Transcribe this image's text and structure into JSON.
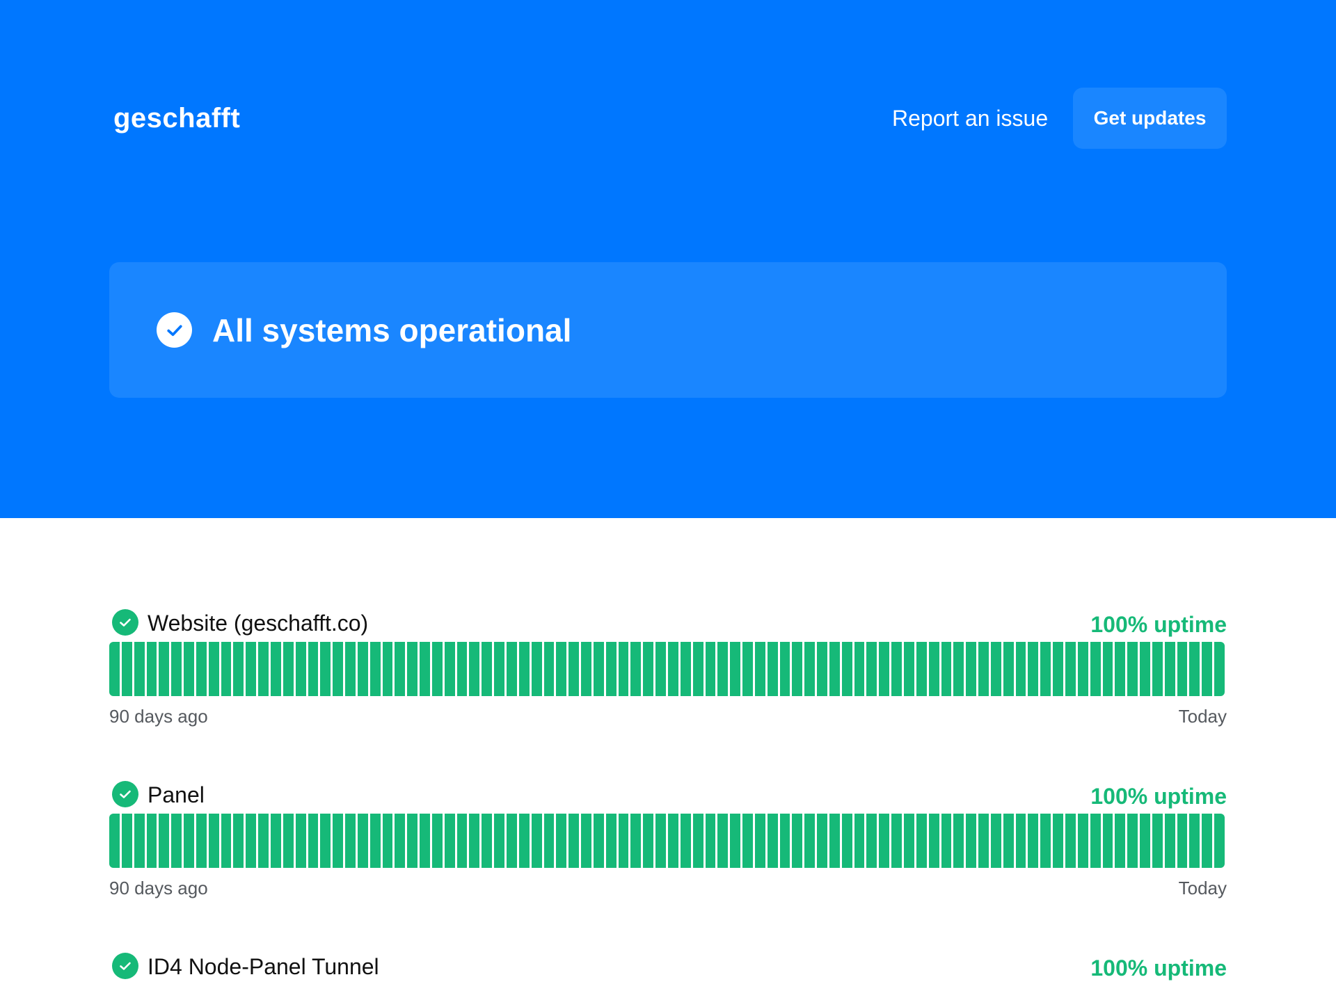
{
  "header": {
    "brand": "geschafft",
    "report_label": "Report an issue",
    "updates_label": "Get updates"
  },
  "status": {
    "text": "All systems operational",
    "icon": "check-circle-icon"
  },
  "colors": {
    "hero_bg": "#0077ff",
    "card_bg": "#1a86ff",
    "operational": "#16b978"
  },
  "components": [
    {
      "name": "Website (geschafft.co)",
      "uptime": "100% uptime",
      "range_start": "90 days ago",
      "range_end": "Today",
      "day_status": [
        "up",
        "up",
        "up",
        "up",
        "up",
        "up",
        "up",
        "up",
        "up",
        "up",
        "up",
        "up",
        "up",
        "up",
        "up",
        "up",
        "up",
        "up",
        "up",
        "up",
        "up",
        "up",
        "up",
        "up",
        "up",
        "up",
        "up",
        "up",
        "up",
        "up",
        "up",
        "up",
        "up",
        "up",
        "up",
        "up",
        "up",
        "up",
        "up",
        "up",
        "up",
        "up",
        "up",
        "up",
        "up",
        "up",
        "up",
        "up",
        "up",
        "up",
        "up",
        "up",
        "up",
        "up",
        "up",
        "up",
        "up",
        "up",
        "up",
        "up",
        "up",
        "up",
        "up",
        "up",
        "up",
        "up",
        "up",
        "up",
        "up",
        "up",
        "up",
        "up",
        "up",
        "up",
        "up",
        "up",
        "up",
        "up",
        "up",
        "up",
        "up",
        "up",
        "up",
        "up",
        "up",
        "up",
        "up",
        "up",
        "up",
        "up"
      ]
    },
    {
      "name": "Panel",
      "uptime": "100% uptime",
      "range_start": "90 days ago",
      "range_end": "Today",
      "day_status": [
        "up",
        "up",
        "up",
        "up",
        "up",
        "up",
        "up",
        "up",
        "up",
        "up",
        "up",
        "up",
        "up",
        "up",
        "up",
        "up",
        "up",
        "up",
        "up",
        "up",
        "up",
        "up",
        "up",
        "up",
        "up",
        "up",
        "up",
        "up",
        "up",
        "up",
        "up",
        "up",
        "up",
        "up",
        "up",
        "up",
        "up",
        "up",
        "up",
        "up",
        "up",
        "up",
        "up",
        "up",
        "up",
        "up",
        "up",
        "up",
        "up",
        "up",
        "up",
        "up",
        "up",
        "up",
        "up",
        "up",
        "up",
        "up",
        "up",
        "up",
        "up",
        "up",
        "up",
        "up",
        "up",
        "up",
        "up",
        "up",
        "up",
        "up",
        "up",
        "up",
        "up",
        "up",
        "up",
        "up",
        "up",
        "up",
        "up",
        "up",
        "up",
        "up",
        "up",
        "up",
        "up",
        "up",
        "up",
        "up",
        "up",
        "up"
      ]
    },
    {
      "name": "ID4 Node-Panel Tunnel",
      "uptime": "100% uptime"
    }
  ]
}
